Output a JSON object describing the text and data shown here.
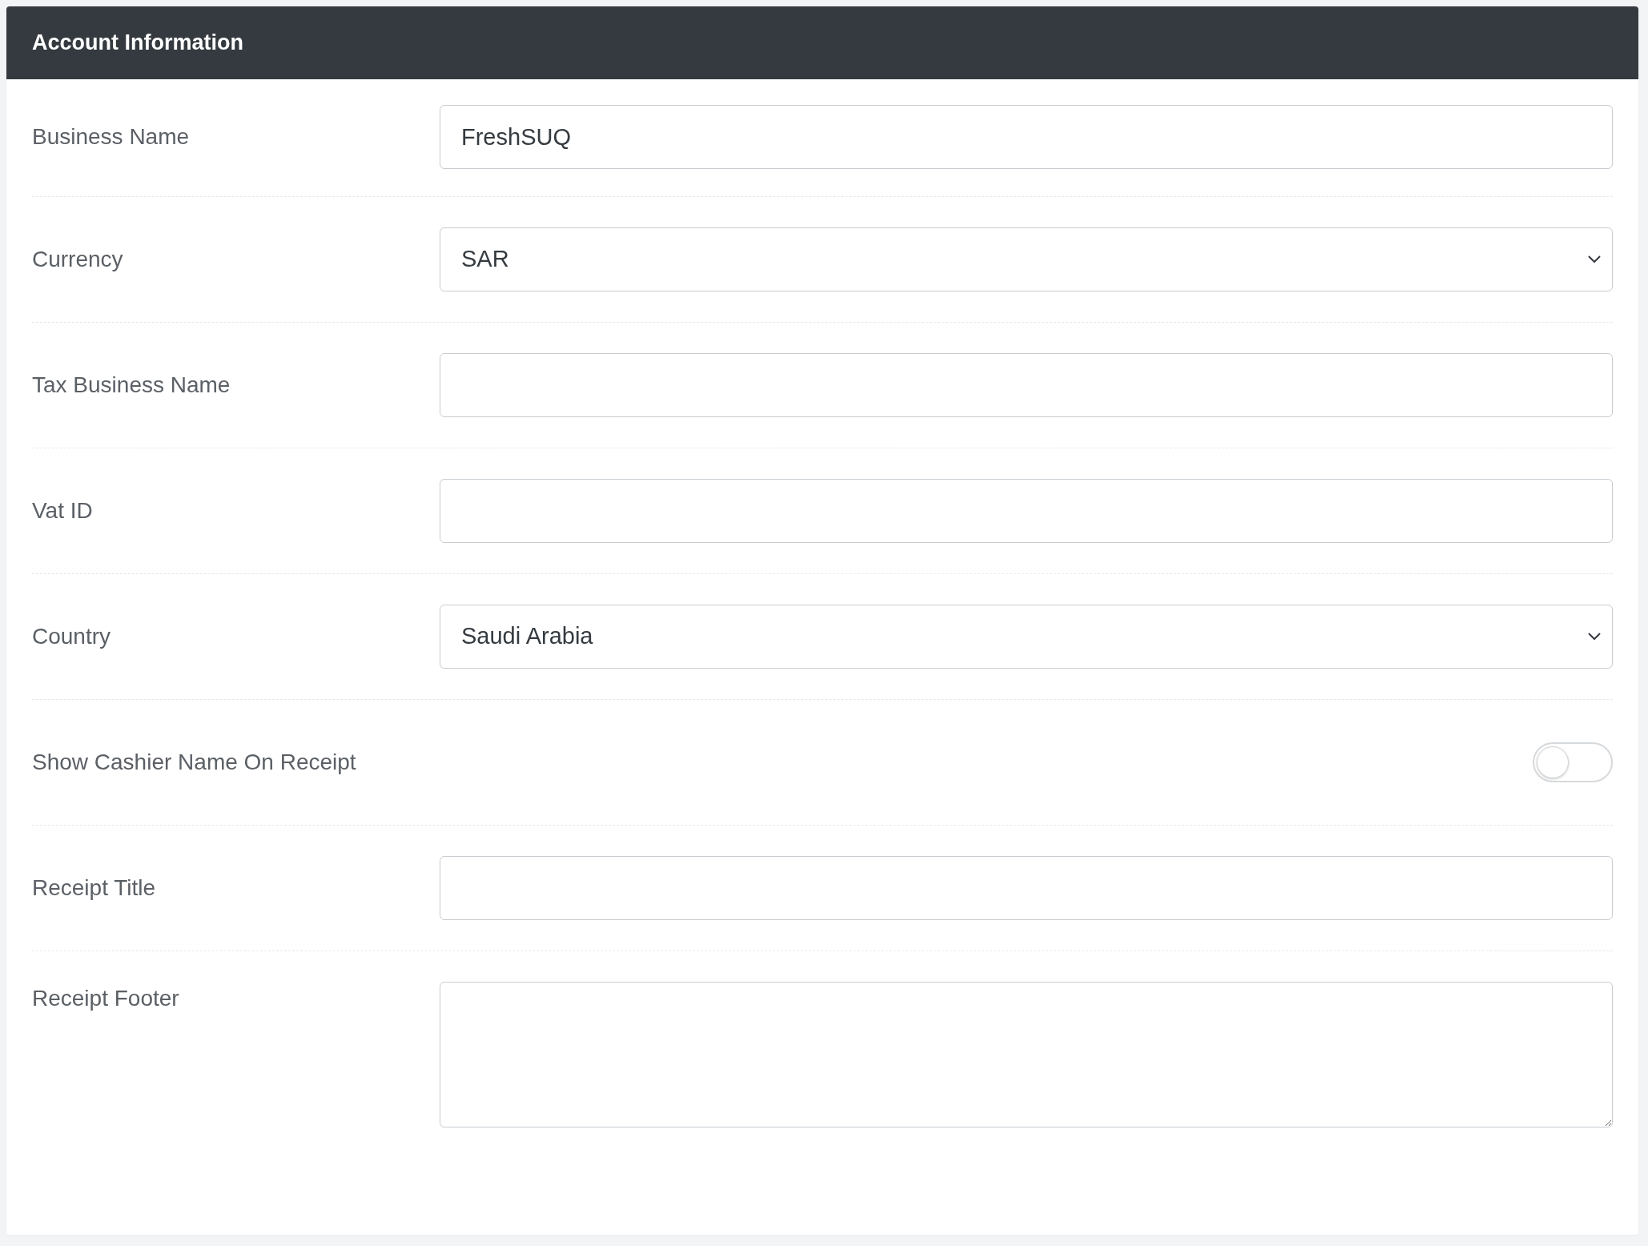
{
  "card": {
    "title": "Account Information"
  },
  "fields": [
    {
      "kind": "text",
      "label": "Business Name",
      "value": "FreshSUQ"
    },
    {
      "kind": "select",
      "label": "Currency",
      "value": "SAR"
    },
    {
      "kind": "text",
      "label": "Tax Business Name"
    },
    {
      "kind": "text",
      "label": "Vat ID"
    },
    {
      "kind": "select",
      "label": "Country",
      "value": "Saudi Arabia"
    },
    {
      "kind": "toggle",
      "label": "Show Cashier Name On Receipt",
      "checked": false
    },
    {
      "kind": "text",
      "label": "Receipt Title"
    },
    {
      "kind": "textarea",
      "label": "Receipt Footer"
    }
  ]
}
